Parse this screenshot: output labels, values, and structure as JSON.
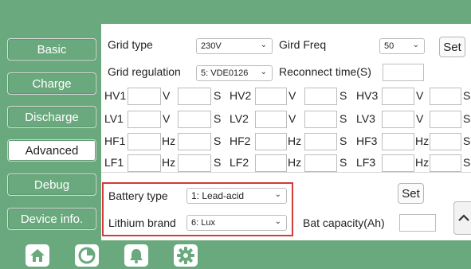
{
  "sidebar": {
    "items": [
      {
        "label": "Basic"
      },
      {
        "label": "Charge"
      },
      {
        "label": "Discharge"
      },
      {
        "label": "Advanced"
      },
      {
        "label": "Debug"
      },
      {
        "label": "Device info."
      }
    ],
    "active": "Advanced"
  },
  "grid": {
    "type_label": "Grid type",
    "type_value": "230V",
    "freq_label": "Gird Freq",
    "freq_value": "50",
    "set_label": "Set",
    "regulation_label": "Grid regulation",
    "regulation_value": "5: VDE0126",
    "reconnect_label": "Reconnect time(S)",
    "reconnect_value": ""
  },
  "protection": {
    "rows": [
      {
        "cells": [
          {
            "name": "HV1",
            "unit": "V"
          },
          {
            "name": "HV2",
            "unit": "V"
          },
          {
            "name": "HV3",
            "unit": "V"
          }
        ]
      },
      {
        "cells": [
          {
            "name": "LV1",
            "unit": "V"
          },
          {
            "name": "LV2",
            "unit": "V"
          },
          {
            "name": "LV3",
            "unit": "V"
          }
        ]
      },
      {
        "cells": [
          {
            "name": "HF1",
            "unit": "Hz"
          },
          {
            "name": "HF2",
            "unit": "Hz"
          },
          {
            "name": "HF3",
            "unit": "Hz"
          }
        ]
      },
      {
        "cells": [
          {
            "name": "LF1",
            "unit": "Hz"
          },
          {
            "name": "LF2",
            "unit": "Hz"
          },
          {
            "name": "LF3",
            "unit": "Hz"
          }
        ]
      }
    ],
    "time_unit": "S"
  },
  "battery": {
    "type_label": "Battery type",
    "type_value": "1: Lead-acid",
    "set_label": "Set",
    "lithium_label": "Lithium brand",
    "lithium_value": "6: Lux",
    "capacity_label": "Bat capacity(Ah)",
    "capacity_value": ""
  },
  "bottom_nav": [
    "home-icon",
    "pie-chart-icon",
    "bell-icon",
    "gear-icon"
  ],
  "colors": {
    "bar": "#6aa97d",
    "highlight": "#d33a3a",
    "active_nav": "#6aa97d"
  }
}
